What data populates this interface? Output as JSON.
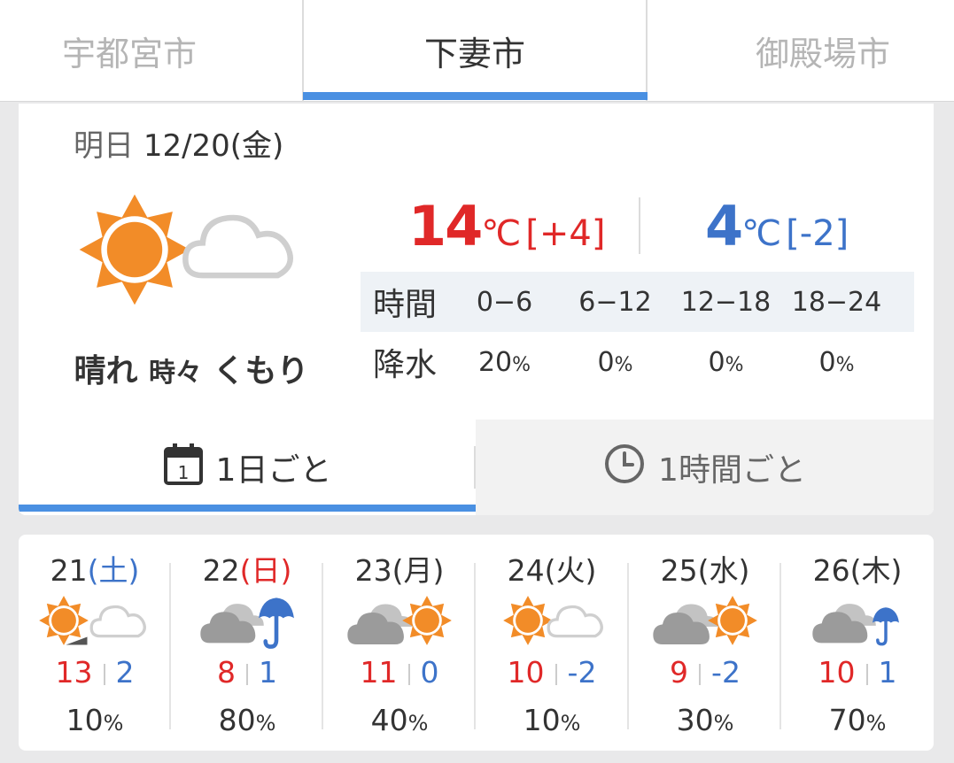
{
  "city_tabs": [
    {
      "label": "宇都宮市",
      "active": false
    },
    {
      "label": "下妻市",
      "active": true
    },
    {
      "label": "御殿場市",
      "active": false
    }
  ],
  "today": {
    "date_label": "明日",
    "date": "12/20(金)",
    "weather_main": "晴れ",
    "weather_mid": "時々",
    "weather_sub": "くもり",
    "icon": "sun-cloud-icon",
    "high": "14",
    "high_unit": "℃",
    "high_diff": "[+4]",
    "low": "4",
    "low_unit": "℃",
    "low_diff": "[-2]",
    "precip": {
      "time_header": "時間",
      "precip_header": "降水",
      "periods": [
        "0−6",
        "6−12",
        "12−18",
        "18−24"
      ],
      "values": [
        "20",
        "0",
        "0",
        "0"
      ],
      "unit": "%"
    }
  },
  "modes": {
    "daily_label": "1日ごと",
    "daily_icon_num": "1",
    "hourly_label": "1時間ごと"
  },
  "week": [
    {
      "day": "21",
      "dow": "(土)",
      "icon": "sun-then-cloud-icon",
      "high": "13",
      "low": "2",
      "precip": "10",
      "unit": "%"
    },
    {
      "day": "22",
      "dow": "(日)",
      "icon": "cloud-umbrella-icon",
      "high": "8",
      "low": "1",
      "precip": "80",
      "unit": "%"
    },
    {
      "day": "23",
      "dow": "(月)",
      "icon": "cloud-sun-icon",
      "high": "11",
      "low": "0",
      "precip": "40",
      "unit": "%"
    },
    {
      "day": "24",
      "dow": "(火)",
      "icon": "sun-cloud-icon",
      "high": "10",
      "low": "-2",
      "precip": "10",
      "unit": "%"
    },
    {
      "day": "25",
      "dow": "(水)",
      "icon": "cloud-sun-icon",
      "high": "9",
      "low": "-2",
      "precip": "30",
      "unit": "%"
    },
    {
      "day": "26",
      "dow": "(木)",
      "icon": "cloud-umbrella-icon",
      "high": "10",
      "low": "1",
      "precip": "70",
      "unit": "%"
    }
  ],
  "colors": {
    "accent": "#4a90e2",
    "high": "#e02828",
    "low": "#3d73c9",
    "sun": "#f28c28",
    "cloud": "#b5b5b5"
  }
}
